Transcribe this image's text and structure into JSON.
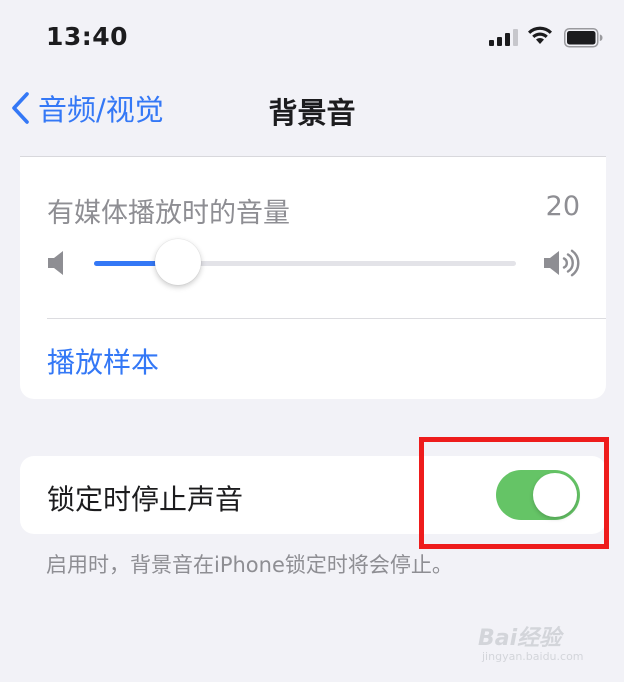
{
  "status_bar": {
    "time": "13:40",
    "signal_bars_active": 3,
    "signal_bars_total": 4
  },
  "nav": {
    "back_label": "音频/视觉",
    "title": "背景音"
  },
  "volume_section": {
    "label": "有媒体播放时的音量",
    "value": "20",
    "slider_fraction": 0.2,
    "play_sample_label": "播放样本"
  },
  "lock_section": {
    "label": "锁定时停止声音",
    "toggle_on": true,
    "footnote": "启用时，背景音在iPhone锁定时将会停止。"
  },
  "watermark": {
    "main": "Bai经验",
    "sub": "jingyan.baidu.com"
  },
  "colors": {
    "accent": "#3478f6",
    "toggle_on": "#65c466",
    "highlight": "#ee1c1c",
    "background": "#f2f2f7"
  },
  "icons": {
    "back": "chevron-left-icon",
    "speaker_low": "speaker-low-icon",
    "speaker_high": "speaker-high-icon",
    "wifi": "wifi-icon",
    "battery": "battery-icon",
    "signal": "cellular-signal-icon"
  }
}
